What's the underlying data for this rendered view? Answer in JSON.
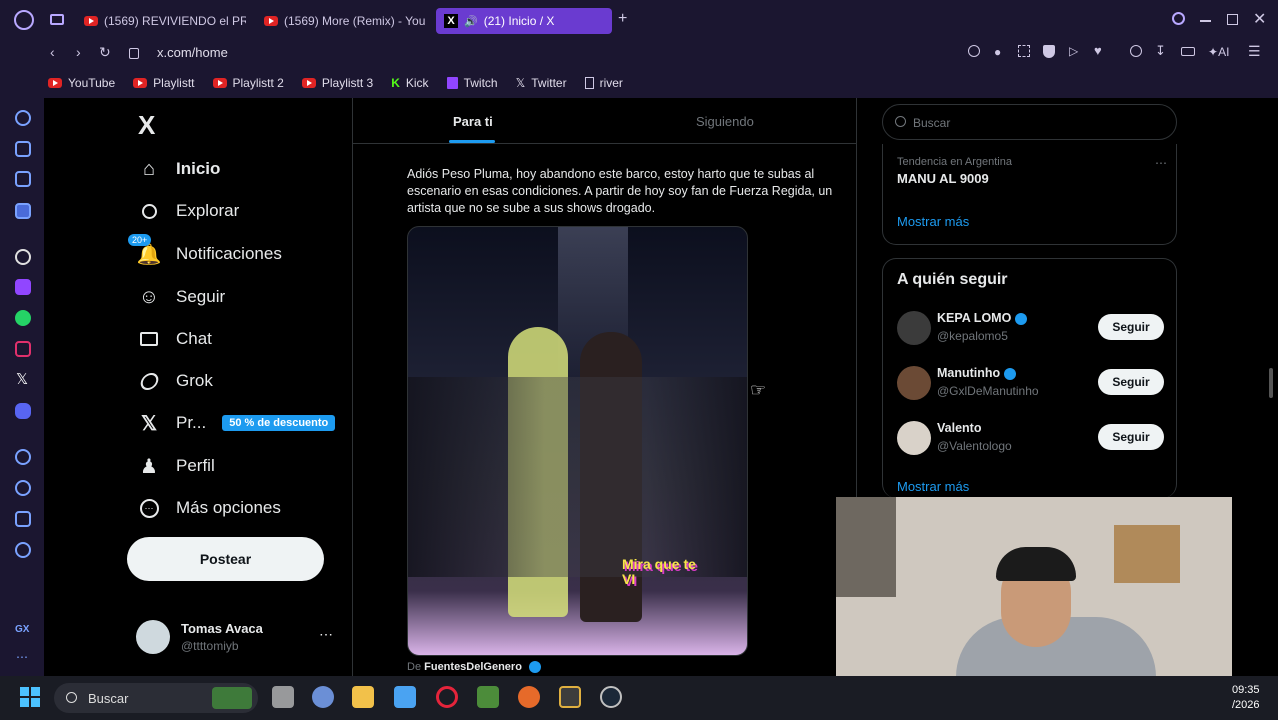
{
  "browser": {
    "tabs": [
      {
        "label": "(1569) REVIVIENDO el PRI"
      },
      {
        "label": "(1569) More (Remix) - You"
      },
      {
        "label": "(21) Inicio / X"
      }
    ],
    "url": "x.com/home",
    "ai_label": "AI",
    "bookmarks": [
      {
        "label": "YouTube"
      },
      {
        "label": "Playlistt"
      },
      {
        "label": "Playlistt 2"
      },
      {
        "label": "Playlistt 3"
      },
      {
        "label": "Kick"
      },
      {
        "label": "Twitch"
      },
      {
        "label": "Twitter"
      },
      {
        "label": "river"
      }
    ],
    "gx_label": "GX"
  },
  "x": {
    "logo": "X",
    "nav": {
      "home": "Inicio",
      "explore": "Explorar",
      "notifications": "Notificaciones",
      "notif_badge": "20+",
      "follow": "Seguir",
      "chat": "Chat",
      "grok": "Grok",
      "premium": "Pr...",
      "premium_badge": "50 % de descuento",
      "profile": "Perfil",
      "more": "Más opciones"
    },
    "post_button": "Postear",
    "account": {
      "name": "Tomas Avaca",
      "handle": "@ttttomiyb"
    },
    "tabs": {
      "for_you": "Para ti",
      "following": "Siguiendo"
    },
    "tweet": {
      "text": "Adiós Peso Pluma, hoy abandono este barco, estoy harto que te subas al escenario en esas condiciones. A partir de hoy soy fan de Fuerza Regida, un artista que no se sube a sus shows drogado.",
      "sticker": "Mira que te VI",
      "source_prefix": "De",
      "source_name": "FuentesDelGenero"
    },
    "search_placeholder": "Buscar",
    "trend": {
      "meta": "Tendencia en Argentina",
      "name": "MANU AL 9009",
      "more": "Mostrar más"
    },
    "who_to_follow": {
      "title": "A quién seguir",
      "users": [
        {
          "name": "KEPA LOMO",
          "handle": "@kepalomo5",
          "button": "Seguir"
        },
        {
          "name": "Manutinho",
          "handle": "@GxlDeManutinho",
          "button": "Seguir"
        },
        {
          "name": "Valento",
          "handle": "@Valentologo",
          "button": "Seguir"
        }
      ],
      "more": "Mostrar más"
    }
  },
  "taskbar": {
    "search": "Buscar",
    "time": "09:35",
    "date": "/2026"
  },
  "colors": {
    "accent": "#1d9bf0",
    "opera_purple": "#6a3bd0",
    "bg": "#000000"
  }
}
